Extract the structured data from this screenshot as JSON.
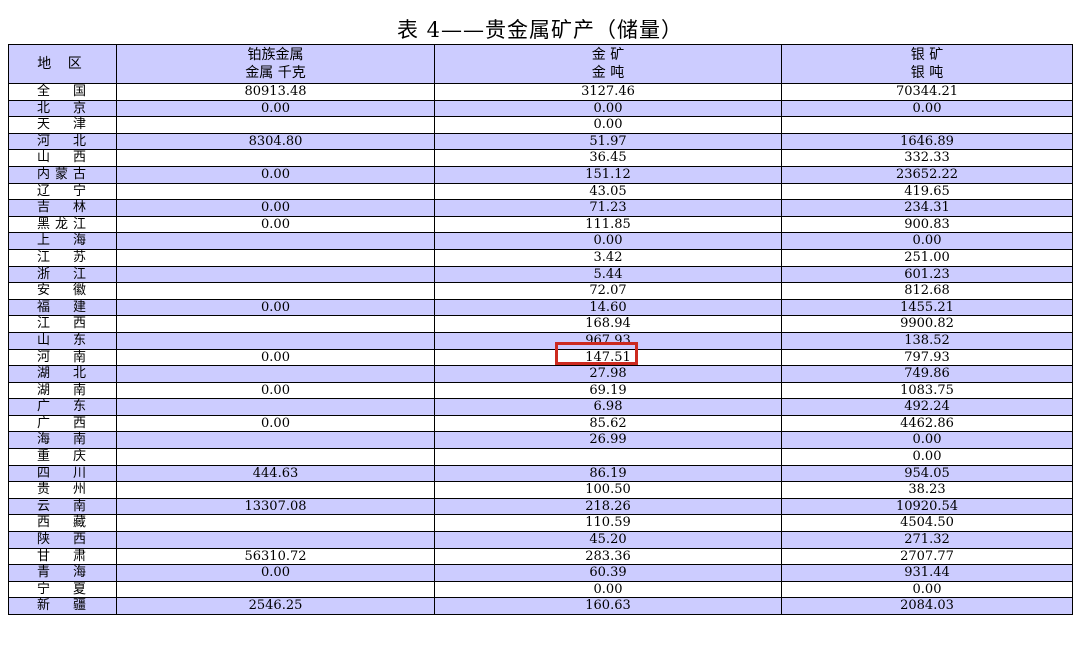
{
  "title": "表 4——贵金属矿产（储量）",
  "headers": {
    "region": "地 区",
    "platinum_line1": "铂族金属",
    "platinum_line2": "金属 千克",
    "gold_line1": "金 矿",
    "gold_line2": "金 吨",
    "silver_line1": "银 矿",
    "silver_line2": "银 吨"
  },
  "rows": [
    {
      "region": "全国",
      "platinum": "80913.48",
      "gold": "3127.46",
      "silver": "70344.21"
    },
    {
      "region": "北京",
      "platinum": "0.00",
      "gold": "0.00",
      "silver": "0.00"
    },
    {
      "region": "天津",
      "platinum": "",
      "gold": "0.00",
      "silver": ""
    },
    {
      "region": "河北",
      "platinum": "8304.80",
      "gold": "51.97",
      "silver": "1646.89"
    },
    {
      "region": "山西",
      "platinum": "",
      "gold": "36.45",
      "silver": "332.33"
    },
    {
      "region": "内蒙古",
      "platinum": "0.00",
      "gold": "151.12",
      "silver": "23652.22"
    },
    {
      "region": "辽宁",
      "platinum": "",
      "gold": "43.05",
      "silver": "419.65"
    },
    {
      "region": "吉林",
      "platinum": "0.00",
      "gold": "71.23",
      "silver": "234.31"
    },
    {
      "region": "黑龙江",
      "platinum": "0.00",
      "gold": "111.85",
      "silver": "900.83"
    },
    {
      "region": "上海",
      "platinum": "",
      "gold": "0.00",
      "silver": "0.00"
    },
    {
      "region": "江苏",
      "platinum": "",
      "gold": "3.42",
      "silver": "251.00"
    },
    {
      "region": "浙江",
      "platinum": "",
      "gold": "5.44",
      "silver": "601.23"
    },
    {
      "region": "安徽",
      "platinum": "",
      "gold": "72.07",
      "silver": "812.68"
    },
    {
      "region": "福建",
      "platinum": "0.00",
      "gold": "14.60",
      "silver": "1455.21"
    },
    {
      "region": "江西",
      "platinum": "",
      "gold": "168.94",
      "silver": "9900.82"
    },
    {
      "region": "山东",
      "platinum": "",
      "gold": "967.93",
      "silver": "138.52"
    },
    {
      "region": "河南",
      "platinum": "0.00",
      "gold": "147.51",
      "silver": "797.93"
    },
    {
      "region": "湖北",
      "platinum": "",
      "gold": "27.98",
      "silver": "749.86"
    },
    {
      "region": "湖南",
      "platinum": "0.00",
      "gold": "69.19",
      "silver": "1083.75"
    },
    {
      "region": "广东",
      "platinum": "",
      "gold": "6.98",
      "silver": "492.24"
    },
    {
      "region": "广西",
      "platinum": "0.00",
      "gold": "85.62",
      "silver": "4462.86"
    },
    {
      "region": "海南",
      "platinum": "",
      "gold": "26.99",
      "silver": "0.00"
    },
    {
      "region": "重庆",
      "platinum": "",
      "gold": "",
      "silver": "0.00"
    },
    {
      "region": "四川",
      "platinum": "444.63",
      "gold": "86.19",
      "silver": "954.05"
    },
    {
      "region": "贵州",
      "platinum": "",
      "gold": "100.50",
      "silver": "38.23"
    },
    {
      "region": "云南",
      "platinum": "13307.08",
      "gold": "218.26",
      "silver": "10920.54"
    },
    {
      "region": "西藏",
      "platinum": "",
      "gold": "110.59",
      "silver": "4504.50"
    },
    {
      "region": "陕西",
      "platinum": "",
      "gold": "45.20",
      "silver": "271.32"
    },
    {
      "region": "甘肃",
      "platinum": "56310.72",
      "gold": "283.36",
      "silver": "2707.77"
    },
    {
      "region": "青海",
      "platinum": "0.00",
      "gold": "60.39",
      "silver": "931.44"
    },
    {
      "region": "宁夏",
      "platinum": "",
      "gold": "0.00",
      "silver": "0.00"
    },
    {
      "region": "新疆",
      "platinum": "2546.25",
      "gold": "160.63",
      "silver": "2084.03"
    }
  ],
  "colors": {
    "header_fill": "#ccccff",
    "alt_row_fill": "#ccccff",
    "highlight_box": "#cc2a1f"
  }
}
